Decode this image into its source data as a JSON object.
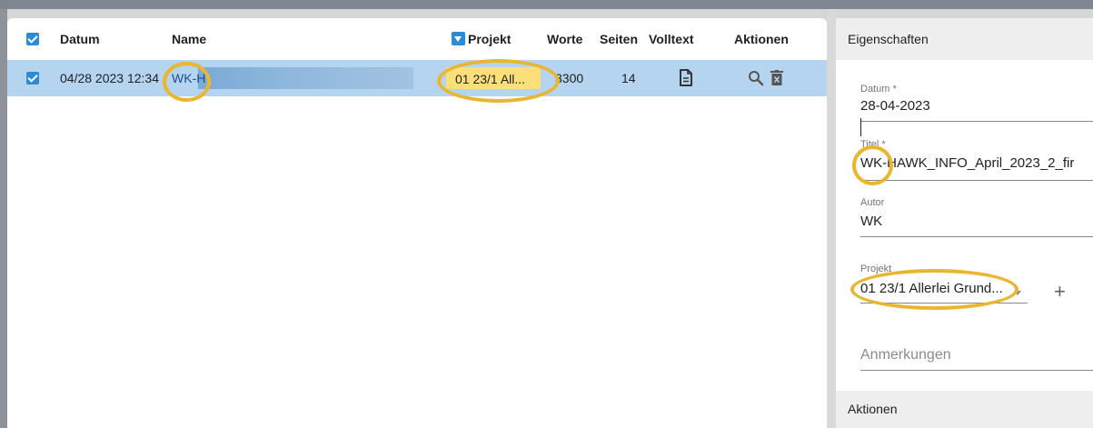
{
  "table": {
    "columns": {
      "datum": "Datum",
      "name": "Name",
      "projekt": "Projekt",
      "worte": "Worte",
      "seiten": "Seiten",
      "volltext": "Volltext",
      "aktionen": "Aktionen"
    },
    "rows": [
      {
        "datum": "04/28 2023 12:34",
        "name": "WK-H",
        "projekt": "01 23/1 All...",
        "worte": "3300",
        "seiten": "14"
      }
    ]
  },
  "properties": {
    "title": "Eigenschaften",
    "datum_label": "Datum *",
    "datum_value": "28-04-2023",
    "titel_label": "Titel *",
    "titel_value": "WK-HAWK_INFO_April_2023_2_fir",
    "autor_label": "Autor",
    "autor_value": "WK",
    "projekt_label": "Projekt",
    "projekt_value": "01 23/1 Allerlei Grund...",
    "anmerkungen_placeholder": "Anmerkungen",
    "aktionen_section": "Aktionen"
  },
  "icons": {
    "select_all": "checkbox-checked-icon",
    "row_select": "checkbox-checked-icon",
    "sort": "sort-down-icon",
    "volltext": "document-icon",
    "search": "search-icon",
    "delete": "trash-icon",
    "dropdown": "chevron-down-icon",
    "add": "plus-icon"
  },
  "colors": {
    "accent": "#2b8bd6",
    "selected_row": "#b4d4f0",
    "project_tag": "#fbe07a",
    "annotation": "#eab630"
  }
}
